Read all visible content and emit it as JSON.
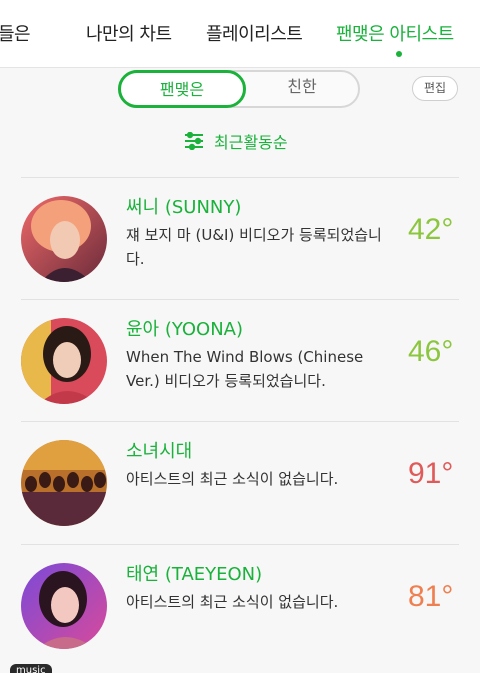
{
  "tabs": [
    {
      "label": "들은",
      "active": false
    },
    {
      "label": "나만의 차트",
      "active": false
    },
    {
      "label": "플레이리스트",
      "active": false
    },
    {
      "label": "팬맺은 아티스트",
      "active": true
    }
  ],
  "toggle": {
    "option1": "팬맺은",
    "option2": "친한"
  },
  "edit_label": "편집",
  "sort_label": "최근활동순",
  "artists": [
    {
      "name": "써니 (SUNNY)",
      "desc": "쟤 보지 마 (U&I) 비디오가 등록되었습니다.",
      "temp": "42°",
      "temp_color": "#8cc63f"
    },
    {
      "name": "윤아 (YOONA)",
      "desc": "When The Wind Blows (Chinese Ver.) 비디오가 등록되었습니다.",
      "temp": "46°",
      "temp_color": "#8cc63f"
    },
    {
      "name": "소녀시대",
      "desc": "아티스트의 최근 소식이 없습니다.",
      "temp": "91°",
      "temp_color": "#e05a5a"
    },
    {
      "name": "태연 (TAEYEON)",
      "desc": "아티스트의 최근 소식이 없습니다.",
      "temp": "81°",
      "temp_color": "#f07f4f"
    }
  ],
  "footer_tag": "music",
  "colors": {
    "accent": "#1ab23b"
  }
}
